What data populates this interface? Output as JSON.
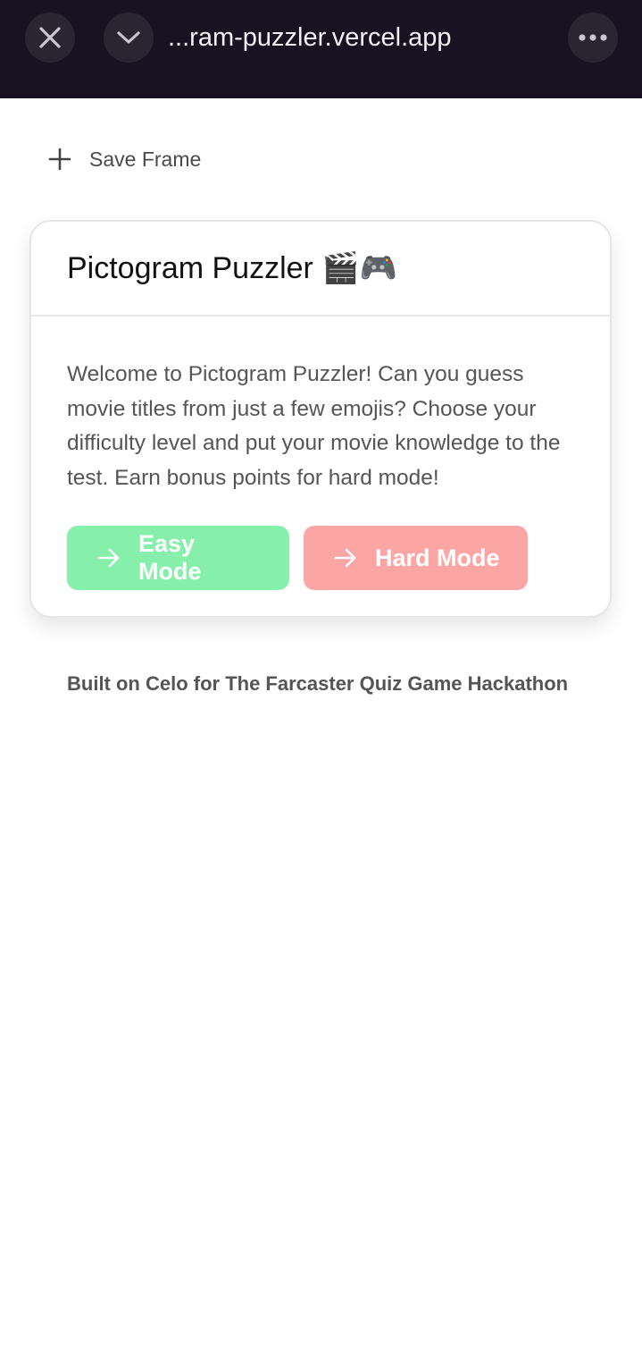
{
  "browser": {
    "url": "...ram-puzzler.vercel.app",
    "close_icon": "close-icon",
    "chevron_icon": "chevron-down-icon",
    "more_icon": "more-horizontal-icon"
  },
  "save_frame": {
    "label": "Save Frame",
    "icon": "plus-icon"
  },
  "card": {
    "title": "Pictogram Puzzler 🎬🎮",
    "description": "Welcome to Pictogram Puzzler! Can you guess movie titles from just a few emojis? Choose your difficulty level and put your movie knowledge to the test. Earn bonus points for hard mode!",
    "buttons": [
      {
        "label": "Easy Mode",
        "icon": "arrow-right-icon",
        "color": "#86efac"
      },
      {
        "label": "Hard Mode",
        "icon": "arrow-right-icon",
        "color": "#fca5a5"
      }
    ]
  },
  "footer": {
    "text": "Built on Celo for The Farcaster Quiz Game Hackathon"
  }
}
